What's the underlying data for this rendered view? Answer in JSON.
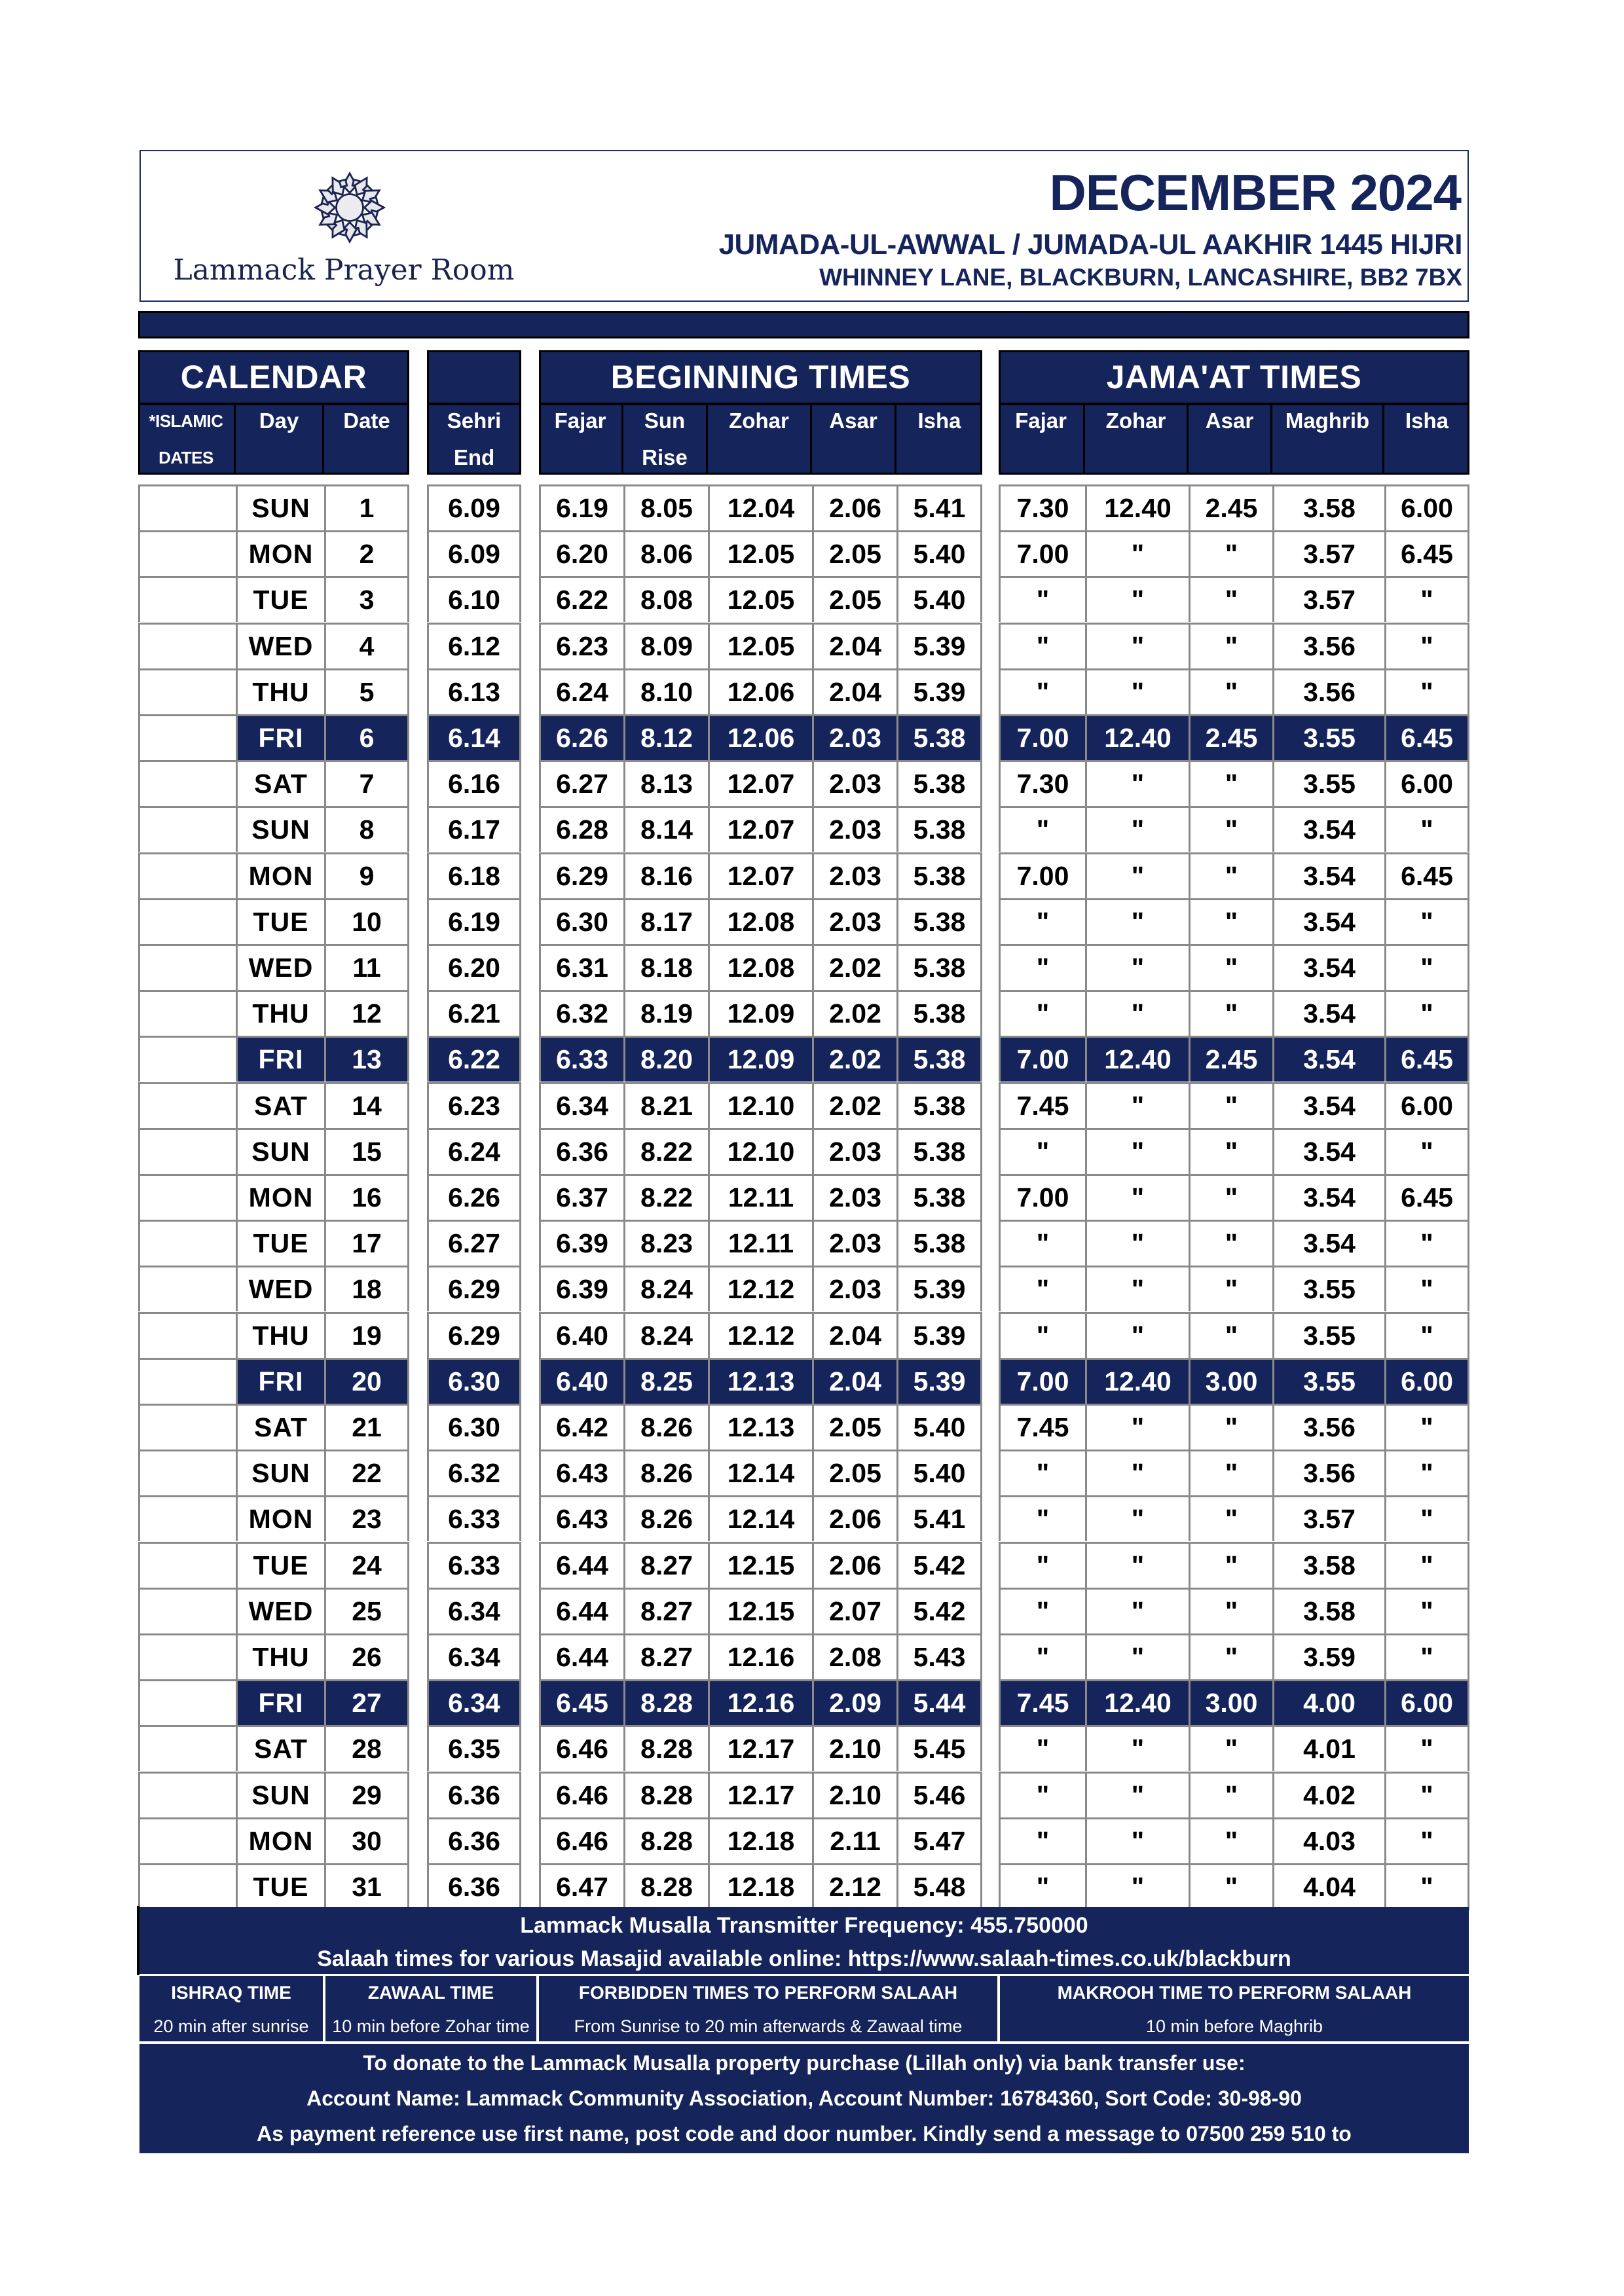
{
  "header": {
    "logo_text": "Lammack Prayer Room",
    "title": "DECEMBER 2024",
    "hijri": "JUMADA-UL-AWWAL / JUMADA-UL AAKHIR 1445 HIJRI",
    "address": "WHINNEY LANE, BLACKBURN, LANCASHIRE, BB2 7BX"
  },
  "colors": {
    "navy": "#15245a",
    "grid": "#8a8a8a",
    "highlight_text": "#ffffff"
  },
  "blocks": {
    "calendar": {
      "title": "CALENDAR",
      "columns": [
        "*ISLAMIC DATES",
        "Day",
        "Date"
      ]
    },
    "sehri": {
      "title": "",
      "columns": [
        "Sehri End"
      ]
    },
    "beginning": {
      "title": "BEGINNING TIMES",
      "columns": [
        "Fajar",
        "Sun Rise",
        "Zohar",
        "Asar",
        "Isha"
      ]
    },
    "jamaat": {
      "title": "JAMA'AT TIMES",
      "columns": [
        "Fajar",
        "Zohar",
        "Asar",
        "Maghrib",
        "Isha"
      ]
    }
  },
  "rows": [
    {
      "islamic": "",
      "day": "SUN",
      "date": "1",
      "sehri": "6.09",
      "b": [
        "6.19",
        "8.05",
        "12.04",
        "2.06",
        "5.41"
      ],
      "j": [
        "7.30",
        "12.40",
        "2.45",
        "3.58",
        "6.00"
      ],
      "friday": false
    },
    {
      "islamic": "",
      "day": "MON",
      "date": "2",
      "sehri": "6.09",
      "b": [
        "6.20",
        "8.06",
        "12.05",
        "2.05",
        "5.40"
      ],
      "j": [
        "7.00",
        "\"",
        "\"",
        "3.57",
        "6.45"
      ],
      "friday": false
    },
    {
      "islamic": "",
      "day": "TUE",
      "date": "3",
      "sehri": "6.10",
      "b": [
        "6.22",
        "8.08",
        "12.05",
        "2.05",
        "5.40"
      ],
      "j": [
        "\"",
        "\"",
        "\"",
        "3.57",
        "\""
      ],
      "friday": false
    },
    {
      "islamic": "",
      "day": "WED",
      "date": "4",
      "sehri": "6.12",
      "b": [
        "6.23",
        "8.09",
        "12.05",
        "2.04",
        "5.39"
      ],
      "j": [
        "\"",
        "\"",
        "\"",
        "3.56",
        "\""
      ],
      "friday": false
    },
    {
      "islamic": "",
      "day": "THU",
      "date": "5",
      "sehri": "6.13",
      "b": [
        "6.24",
        "8.10",
        "12.06",
        "2.04",
        "5.39"
      ],
      "j": [
        "\"",
        "\"",
        "\"",
        "3.56",
        "\""
      ],
      "friday": false
    },
    {
      "islamic": "",
      "day": "FRI",
      "date": "6",
      "sehri": "6.14",
      "b": [
        "6.26",
        "8.12",
        "12.06",
        "2.03",
        "5.38"
      ],
      "j": [
        "7.00",
        "12.40",
        "2.45",
        "3.55",
        "6.45"
      ],
      "friday": true
    },
    {
      "islamic": "",
      "day": "SAT",
      "date": "7",
      "sehri": "6.16",
      "b": [
        "6.27",
        "8.13",
        "12.07",
        "2.03",
        "5.38"
      ],
      "j": [
        "7.30",
        "\"",
        "\"",
        "3.55",
        "6.00"
      ],
      "friday": false
    },
    {
      "islamic": "",
      "day": "SUN",
      "date": "8",
      "sehri": "6.17",
      "b": [
        "6.28",
        "8.14",
        "12.07",
        "2.03",
        "5.38"
      ],
      "j": [
        "\"",
        "\"",
        "\"",
        "3.54",
        "\""
      ],
      "friday": false
    },
    {
      "islamic": "",
      "day": "MON",
      "date": "9",
      "sehri": "6.18",
      "b": [
        "6.29",
        "8.16",
        "12.07",
        "2.03",
        "5.38"
      ],
      "j": [
        "7.00",
        "\"",
        "\"",
        "3.54",
        "6.45"
      ],
      "friday": false
    },
    {
      "islamic": "",
      "day": "TUE",
      "date": "10",
      "sehri": "6.19",
      "b": [
        "6.30",
        "8.17",
        "12.08",
        "2.03",
        "5.38"
      ],
      "j": [
        "\"",
        "\"",
        "\"",
        "3.54",
        "\""
      ],
      "friday": false
    },
    {
      "islamic": "",
      "day": "WED",
      "date": "11",
      "sehri": "6.20",
      "b": [
        "6.31",
        "8.18",
        "12.08",
        "2.02",
        "5.38"
      ],
      "j": [
        "\"",
        "\"",
        "\"",
        "3.54",
        "\""
      ],
      "friday": false
    },
    {
      "islamic": "",
      "day": "THU",
      "date": "12",
      "sehri": "6.21",
      "b": [
        "6.32",
        "8.19",
        "12.09",
        "2.02",
        "5.38"
      ],
      "j": [
        "\"",
        "\"",
        "\"",
        "3.54",
        "\""
      ],
      "friday": false
    },
    {
      "islamic": "",
      "day": "FRI",
      "date": "13",
      "sehri": "6.22",
      "b": [
        "6.33",
        "8.20",
        "12.09",
        "2.02",
        "5.38"
      ],
      "j": [
        "7.00",
        "12.40",
        "2.45",
        "3.54",
        "6.45"
      ],
      "friday": true
    },
    {
      "islamic": "",
      "day": "SAT",
      "date": "14",
      "sehri": "6.23",
      "b": [
        "6.34",
        "8.21",
        "12.10",
        "2.02",
        "5.38"
      ],
      "j": [
        "7.45",
        "\"",
        "\"",
        "3.54",
        "6.00"
      ],
      "friday": false
    },
    {
      "islamic": "",
      "day": "SUN",
      "date": "15",
      "sehri": "6.24",
      "b": [
        "6.36",
        "8.22",
        "12.10",
        "2.03",
        "5.38"
      ],
      "j": [
        "\"",
        "\"",
        "\"",
        "3.54",
        "\""
      ],
      "friday": false
    },
    {
      "islamic": "",
      "day": "MON",
      "date": "16",
      "sehri": "6.26",
      "b": [
        "6.37",
        "8.22",
        "12.11",
        "2.03",
        "5.38"
      ],
      "j": [
        "7.00",
        "\"",
        "\"",
        "3.54",
        "6.45"
      ],
      "friday": false
    },
    {
      "islamic": "",
      "day": "TUE",
      "date": "17",
      "sehri": "6.27",
      "b": [
        "6.39",
        "8.23",
        "12.11",
        "2.03",
        "5.38"
      ],
      "j": [
        "\"",
        "\"",
        "\"",
        "3.54",
        "\""
      ],
      "friday": false
    },
    {
      "islamic": "",
      "day": "WED",
      "date": "18",
      "sehri": "6.29",
      "b": [
        "6.39",
        "8.24",
        "12.12",
        "2.03",
        "5.39"
      ],
      "j": [
        "\"",
        "\"",
        "\"",
        "3.55",
        "\""
      ],
      "friday": false
    },
    {
      "islamic": "",
      "day": "THU",
      "date": "19",
      "sehri": "6.29",
      "b": [
        "6.40",
        "8.24",
        "12.12",
        "2.04",
        "5.39"
      ],
      "j": [
        "\"",
        "\"",
        "\"",
        "3.55",
        "\""
      ],
      "friday": false
    },
    {
      "islamic": "",
      "day": "FRI",
      "date": "20",
      "sehri": "6.30",
      "b": [
        "6.40",
        "8.25",
        "12.13",
        "2.04",
        "5.39"
      ],
      "j": [
        "7.00",
        "12.40",
        "3.00",
        "3.55",
        "6.00"
      ],
      "friday": true
    },
    {
      "islamic": "",
      "day": "SAT",
      "date": "21",
      "sehri": "6.30",
      "b": [
        "6.42",
        "8.26",
        "12.13",
        "2.05",
        "5.40"
      ],
      "j": [
        "7.45",
        "\"",
        "\"",
        "3.56",
        "\""
      ],
      "friday": false
    },
    {
      "islamic": "",
      "day": "SUN",
      "date": "22",
      "sehri": "6.32",
      "b": [
        "6.43",
        "8.26",
        "12.14",
        "2.05",
        "5.40"
      ],
      "j": [
        "\"",
        "\"",
        "\"",
        "3.56",
        "\""
      ],
      "friday": false
    },
    {
      "islamic": "",
      "day": "MON",
      "date": "23",
      "sehri": "6.33",
      "b": [
        "6.43",
        "8.26",
        "12.14",
        "2.06",
        "5.41"
      ],
      "j": [
        "\"",
        "\"",
        "\"",
        "3.57",
        "\""
      ],
      "friday": false
    },
    {
      "islamic": "",
      "day": "TUE",
      "date": "24",
      "sehri": "6.33",
      "b": [
        "6.44",
        "8.27",
        "12.15",
        "2.06",
        "5.42"
      ],
      "j": [
        "\"",
        "\"",
        "\"",
        "3.58",
        "\""
      ],
      "friday": false
    },
    {
      "islamic": "",
      "day": "WED",
      "date": "25",
      "sehri": "6.34",
      "b": [
        "6.44",
        "8.27",
        "12.15",
        "2.07",
        "5.42"
      ],
      "j": [
        "\"",
        "\"",
        "\"",
        "3.58",
        "\""
      ],
      "friday": false
    },
    {
      "islamic": "",
      "day": "THU",
      "date": "26",
      "sehri": "6.34",
      "b": [
        "6.44",
        "8.27",
        "12.16",
        "2.08",
        "5.43"
      ],
      "j": [
        "\"",
        "\"",
        "\"",
        "3.59",
        "\""
      ],
      "friday": false
    },
    {
      "islamic": "",
      "day": "FRI",
      "date": "27",
      "sehri": "6.34",
      "b": [
        "6.45",
        "8.28",
        "12.16",
        "2.09",
        "5.44"
      ],
      "j": [
        "7.45",
        "12.40",
        "3.00",
        "4.00",
        "6.00"
      ],
      "friday": true
    },
    {
      "islamic": "",
      "day": "SAT",
      "date": "28",
      "sehri": "6.35",
      "b": [
        "6.46",
        "8.28",
        "12.17",
        "2.10",
        "5.45"
      ],
      "j": [
        "\"",
        "\"",
        "\"",
        "4.01",
        "\""
      ],
      "friday": false
    },
    {
      "islamic": "",
      "day": "SUN",
      "date": "29",
      "sehri": "6.36",
      "b": [
        "6.46",
        "8.28",
        "12.17",
        "2.10",
        "5.46"
      ],
      "j": [
        "\"",
        "\"",
        "\"",
        "4.02",
        "\""
      ],
      "friday": false
    },
    {
      "islamic": "",
      "day": "MON",
      "date": "30",
      "sehri": "6.36",
      "b": [
        "6.46",
        "8.28",
        "12.18",
        "2.11",
        "5.47"
      ],
      "j": [
        "\"",
        "\"",
        "\"",
        "4.03",
        "\""
      ],
      "friday": false
    },
    {
      "islamic": "",
      "day": "TUE",
      "date": "31",
      "sehri": "6.36",
      "b": [
        "6.47",
        "8.28",
        "12.18",
        "2.12",
        "5.48"
      ],
      "j": [
        "\"",
        "\"",
        "\"",
        "4.04",
        "\""
      ],
      "friday": false
    }
  ],
  "footer": {
    "frequency": "Lammack Musalla Transmitter Frequency: 455.750000",
    "online": "Salaah times for various Masajid available online: https://www.salaah-times.co.uk/blackburn",
    "info": [
      {
        "title": "ISHRAQ TIME",
        "text": "20 min after sunrise"
      },
      {
        "title": "ZAWAAL TIME",
        "text": "10 min before Zohar time"
      },
      {
        "title": "FORBIDDEN TIMES TO PERFORM SALAAH",
        "text": "From Sunrise to 20 min afterwards & Zawaal time"
      },
      {
        "title": "MAKROOH TIME TO PERFORM SALAAH",
        "text": "10 min before Maghrib"
      }
    ],
    "donate": [
      "To donate to the Lammack Musalla property purchase (Lillah only) via bank transfer use:",
      "Account Name: Lammack Community Association, Account Number: 16784360, Sort Code: 30-98-90",
      "As payment reference use first name, post code and door number.  Kindly send a message to 07500 259 510 to"
    ]
  }
}
